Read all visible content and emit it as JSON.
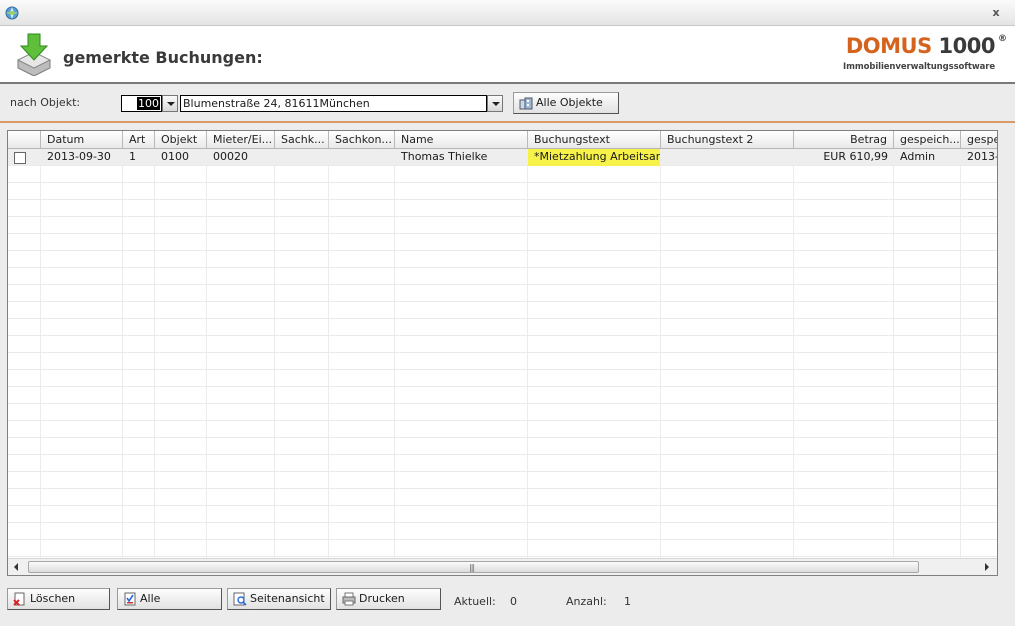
{
  "window": {
    "close_label": "x"
  },
  "header": {
    "title": "gemerkte Buchungen:"
  },
  "logo": {
    "brand": "DOMUS",
    "number": "1000",
    "reg": "®",
    "tagline": "Immobilienverwaltungssoftware"
  },
  "filter": {
    "label": "nach Objekt:",
    "object_code": "100",
    "object_name": "Blumenstraße 24, 81611München",
    "all_objects_label": "Alle Objekte"
  },
  "grid": {
    "columns": [
      "",
      "Datum",
      "Art",
      "Objekt",
      "Mieter/Ei...",
      "Sachk...",
      "Sachkon...",
      "Name",
      "Buchungstext",
      "Buchungstext 2",
      "Betrag",
      "gespeich...",
      "gespe"
    ],
    "rows": [
      {
        "checked": false,
        "cells": [
          "2013-09-30",
          "1",
          "0100",
          "00020",
          "",
          "",
          "Thomas Thielke",
          "*Mietzahlung Arbeitsamt",
          "",
          "EUR 610,99",
          "Admin",
          "2013-"
        ]
      }
    ],
    "highlight_color": "#f6f24a",
    "scroll_grip": "|||"
  },
  "footer": {
    "delete_label": "Löschen",
    "all_label": "Alle",
    "preview_label": "Seitenansicht",
    "print_label": "Drucken",
    "current_label": "Aktuell:",
    "current_value": "0",
    "count_label": "Anzahl:",
    "count_value": "1"
  },
  "colors": {
    "accent": "#d4631e",
    "rule": "#d99a6a"
  }
}
